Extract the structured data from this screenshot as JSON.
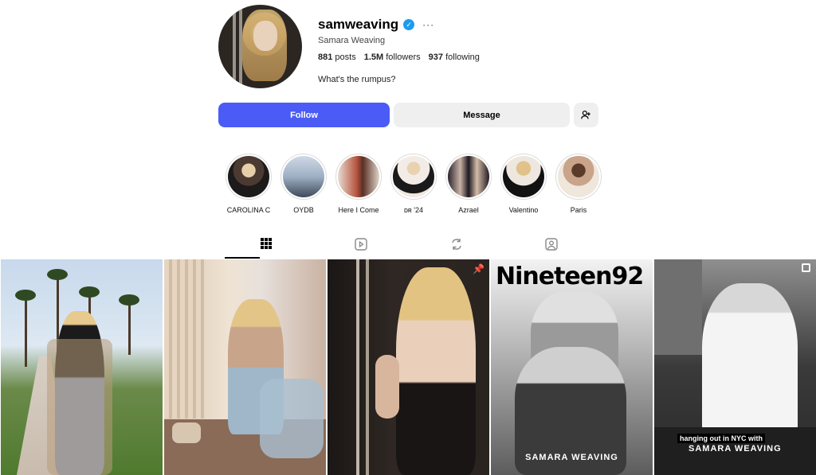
{
  "profile": {
    "username": "samweaving",
    "verified_icon": "verified-badge-icon",
    "more_icon": "more-options-icon",
    "full_name": "Samara Weaving",
    "posts_count": "881",
    "posts_label": "posts",
    "followers_count": "1.5M",
    "followers_label": "followers",
    "following_count": "937",
    "following_label": "following",
    "bio": "What's the rumpus?"
  },
  "actions": {
    "follow_label": "Follow",
    "message_label": "Message",
    "add_user_icon": "add-user-icon"
  },
  "highlights": [
    {
      "label": "CAROLINA C"
    },
    {
      "label": "OYDB"
    },
    {
      "label": "Here I Come"
    },
    {
      "label": "ᴅʀ '24"
    },
    {
      "label": "Azrael"
    },
    {
      "label": "Valentino"
    },
    {
      "label": "Paris"
    }
  ],
  "tabs": [
    {
      "icon": "grid-icon",
      "active": true
    },
    {
      "icon": "reels-icon",
      "active": false
    },
    {
      "icon": "reposts-icon",
      "active": false
    },
    {
      "icon": "tagged-icon",
      "active": false
    }
  ],
  "posts": {
    "p3_pin_icon": "pin-icon",
    "p4_magazine_title": "Nineteen92",
    "p4_footer": "SAMARA WEAVING",
    "p5_caption_line1": "hanging out in NYC with",
    "p5_caption_line2": "SAMARA WEAVING",
    "p5_multi_icon": "carousel-icon"
  },
  "colors": {
    "follow_button": "#4a5cf5",
    "secondary_button": "#efefef",
    "verified": "#1d9bf0"
  }
}
